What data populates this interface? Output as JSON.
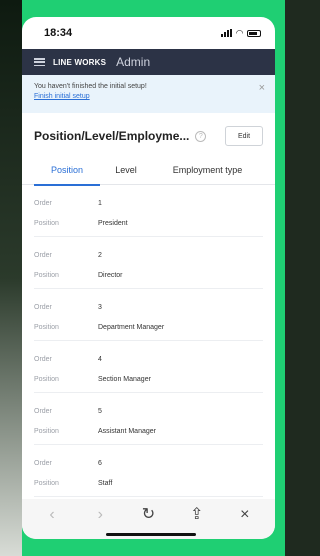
{
  "status_bar": {
    "time": "18:34"
  },
  "app": {
    "brand": "LINE WORKS",
    "section": "Admin"
  },
  "notice": {
    "message": "You haven't finished the initial setup!",
    "link": "Finish initial setup",
    "close_icon": "×"
  },
  "page": {
    "title": "Position/Level/Employme...",
    "help_icon": "?",
    "edit_label": "Edit"
  },
  "tabs": [
    {
      "label": "Position",
      "active": true
    },
    {
      "label": "Level",
      "active": false
    },
    {
      "label": "Employment type",
      "active": false
    }
  ],
  "field_labels": {
    "order": "Order",
    "position": "Position"
  },
  "positions": [
    {
      "order": "1",
      "name": "President"
    },
    {
      "order": "2",
      "name": "Director"
    },
    {
      "order": "3",
      "name": "Department Manager"
    },
    {
      "order": "4",
      "name": "Section Manager"
    },
    {
      "order": "5",
      "name": "Assistant Manager"
    },
    {
      "order": "6",
      "name": "Staff"
    }
  ],
  "browser_toolbar": {
    "back_icon": "‹",
    "forward_icon": "›",
    "reload_icon": "↻",
    "share_icon": "⇪",
    "close_icon": "×"
  },
  "colors": {
    "frame_green": "#1fcf73",
    "appbar": "#2c3346",
    "accent_blue": "#2a6fd6",
    "notice_bg": "#e9f3fb"
  }
}
